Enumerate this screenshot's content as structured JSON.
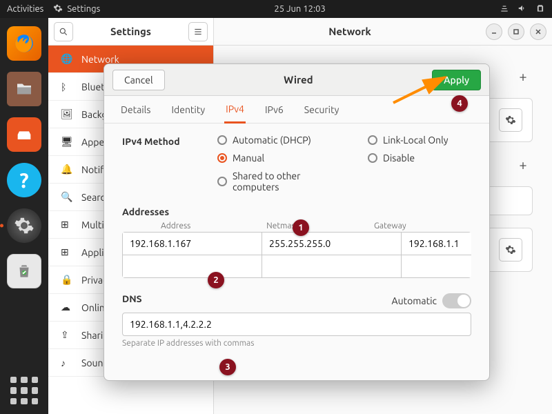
{
  "topbar": {
    "activities": "Activities",
    "app_label": "Settings",
    "clock": "25 Jun  12:03"
  },
  "settings_window": {
    "sidebar_title": "Settings",
    "content_title": "Network",
    "categories": [
      "Network",
      "Bluetooth",
      "Background",
      "Appearance",
      "Notifications",
      "Search",
      "Multitasking",
      "Applications",
      "Privacy",
      "Online Accounts",
      "Sharing",
      "Sound"
    ]
  },
  "dialog": {
    "title": "Wired",
    "cancel": "Cancel",
    "apply": "Apply",
    "tabs": [
      "Details",
      "Identity",
      "IPv4",
      "IPv6",
      "Security"
    ],
    "active_tab": 2,
    "method_label": "IPv4 Method",
    "methods_col1": [
      "Automatic (DHCP)",
      "Manual",
      "Shared to other computers"
    ],
    "methods_col2": [
      "Link-Local Only",
      "Disable"
    ],
    "selected_method": "Manual",
    "addresses_label": "Addresses",
    "addr_headers": [
      "Address",
      "Netmask",
      "Gateway"
    ],
    "addresses": [
      {
        "address": "192.168.1.167",
        "netmask": "255.255.255.0",
        "gateway": "192.168.1.1"
      },
      {
        "address": "",
        "netmask": "",
        "gateway": ""
      }
    ],
    "dns_label": "DNS",
    "dns_automatic_label": "Automatic",
    "dns_value": "192.168.1.1,4.2.2.2",
    "dns_hint": "Separate IP addresses with commas"
  },
  "annotations": {
    "b1": "1",
    "b2": "2",
    "b3": "3",
    "b4": "4"
  }
}
